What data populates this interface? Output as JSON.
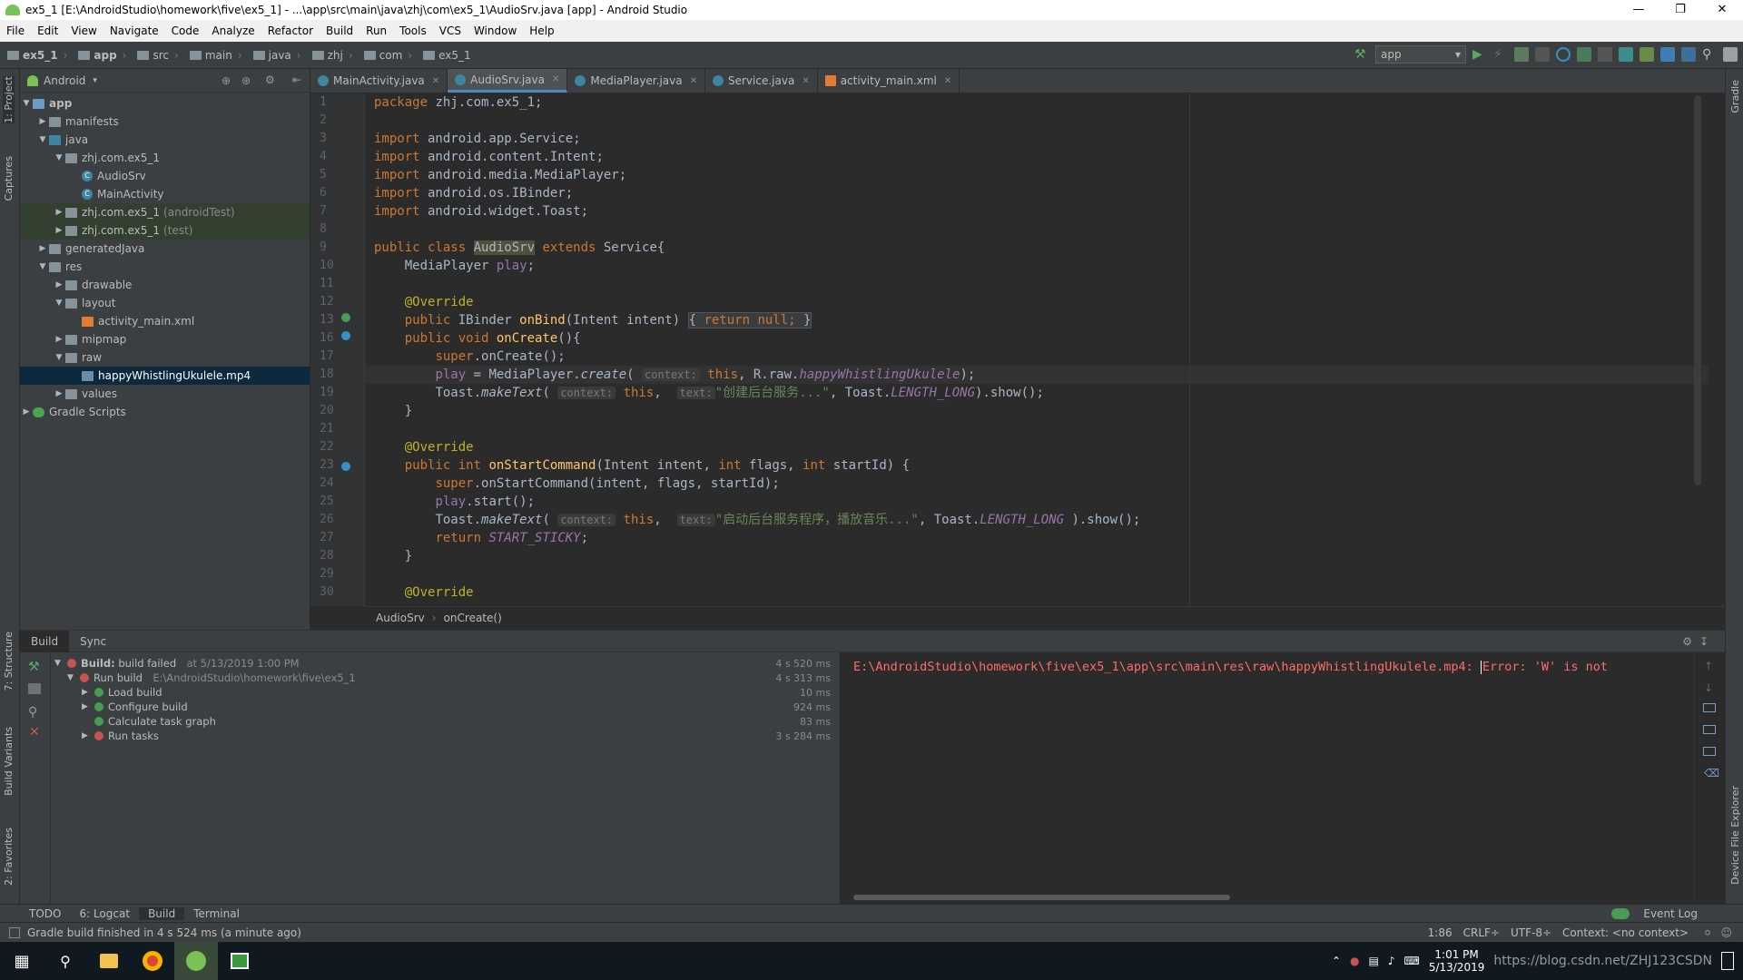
{
  "window": {
    "title": "ex5_1 [E:\\AndroidStudio\\homework\\five\\ex5_1] - ...\\app\\src\\main\\java\\zhj\\com\\ex5_1\\AudioSrv.java [app] - Android Studio"
  },
  "menu": [
    "File",
    "Edit",
    "View",
    "Navigate",
    "Code",
    "Analyze",
    "Refactor",
    "Build",
    "Run",
    "Tools",
    "VCS",
    "Window",
    "Help"
  ],
  "breadcrumbs": [
    "ex5_1",
    "app",
    "src",
    "main",
    "java",
    "zhj",
    "com",
    "ex5_1"
  ],
  "run_config": "app",
  "project_panel": {
    "view": "Android",
    "tree": [
      {
        "label": "app",
        "extra": ""
      },
      {
        "label": "manifests",
        "extra": ""
      },
      {
        "label": "java",
        "extra": ""
      },
      {
        "label": "zhj.com.ex5_1",
        "extra": ""
      },
      {
        "label": "AudioSrv",
        "extra": ""
      },
      {
        "label": "MainActivity",
        "extra": ""
      },
      {
        "label": "zhj.com.ex5_1",
        "extra": "(androidTest)"
      },
      {
        "label": "zhj.com.ex5_1",
        "extra": "(test)"
      },
      {
        "label": "generatedJava",
        "extra": ""
      },
      {
        "label": "res",
        "extra": ""
      },
      {
        "label": "drawable",
        "extra": ""
      },
      {
        "label": "layout",
        "extra": ""
      },
      {
        "label": "activity_main.xml",
        "extra": ""
      },
      {
        "label": "mipmap",
        "extra": ""
      },
      {
        "label": "raw",
        "extra": ""
      },
      {
        "label": "happyWhistlingUkulele.mp4",
        "extra": ""
      },
      {
        "label": "values",
        "extra": ""
      },
      {
        "label": "Gradle Scripts",
        "extra": ""
      }
    ]
  },
  "side_tools": {
    "project": "1: Project",
    "captures": "Captures",
    "structure": "7: Structure",
    "build_variants": "Build Variants",
    "favorites": "2: Favorites",
    "gradle": "Gradle",
    "device_explorer": "Device File Explorer"
  },
  "editor_tabs": [
    "MainActivity.java",
    "AudioSrv.java",
    "MediaPlayer.java",
    "Service.java",
    "activity_main.xml"
  ],
  "line_numbers": [
    "1",
    "2",
    "3",
    "4",
    "5",
    "6",
    "7",
    "8",
    "9",
    "10",
    "11",
    "12",
    "13",
    "16",
    "17",
    "18",
    "19",
    "20",
    "21",
    "22",
    "23",
    "24",
    "25",
    "26",
    "27",
    "28",
    "29",
    "30"
  ],
  "code": {
    "l1a": "package",
    "l1b": " zhj.com.ex5_1;",
    "imp": "import",
    "i1": " android.app.Service;",
    "i2": " android.content.Intent;",
    "i3": " android.media.MediaPlayer;",
    "i4": " android.os.IBinder;",
    "i5": " android.widget.Toast;",
    "cls_kw": "public class ",
    "cls_name": "AudioSrv",
    "ext_kw": " extends ",
    "ext_name": "Service{",
    "fld_type": "    MediaPlayer ",
    "fld_name": "play",
    ";": ";",
    "override": "    @Override",
    "onbind_kw": "    public ",
    "onbind_t": "IBinder ",
    "onbind_fn": "onBind",
    "onbind_args": "(Intent intent) ",
    "onbind_body_kw": "return null;",
    "oncreate_kw": "    public void ",
    "oncreate_fn": "onCreate",
    "oncreate_args": "(){",
    "super1": "super",
    ".oncreate": ".onCreate();",
    "play_assign": "play",
    " = MediaPlayer.": " = MediaPlayer.",
    "create": "create",
    "(": "(",
    "hint_context": "context:",
    "this": "this",
    ", R.raw.": ", R.raw.",
    "rawname": "happyWhistlingUkulele",
    ");": ");",
    "toast": "Toast.",
    "maketext": "makeText",
    "hint_text": "text:",
    "str1": "\"创建后台服务...\"",
    ", Toast.": ", Toast.",
    "LONG": "LENGTH_LONG",
    ").show();": ").show();",
    "closebrace": "    }",
    "onstart_kw": "    public int ",
    "onstart_fn": "onStartCommand",
    "onstart_args1": "(Intent intent, ",
    "int": "int",
    "flags": " flags, ",
    "startId": " startId) {",
    ".onStartCommand": ".onStartCommand(intent, flags, startId);",
    ".start": ".start();",
    "str2": "\"启动后台服务程序，播放音乐...\"",
    " ).show();": " ).show();",
    "return": "return ",
    "sticky": "START_STICKY",
    "indent8": "        "
  },
  "editor_breadcrumb": [
    "AudioSrv",
    "onCreate()"
  ],
  "build_panel": {
    "tabs": [
      "Build",
      "Sync"
    ],
    "rows": [
      {
        "label": "Build:",
        "label2": "build failed",
        "info": "at 5/13/2019 1:00 PM",
        "time": "4 s 520 ms"
      },
      {
        "label": "Run build",
        "info": "E:\\AndroidStudio\\homework\\five\\ex5_1",
        "time": "4 s 313 ms"
      },
      {
        "label": "Load build",
        "time": "10 ms"
      },
      {
        "label": "Configure build",
        "time": "924 ms"
      },
      {
        "label": "Calculate task graph",
        "time": "83 ms"
      },
      {
        "label": "Run tasks",
        "time": "3 s 284 ms"
      }
    ],
    "output_path": "E:\\AndroidStudio\\homework\\five\\ex5_1\\app\\src\\main\\res\\raw\\happyWhistlingUkulele.mp4: ",
    "output_error": "Error: 'W' is not"
  },
  "bottom_tabs": [
    "TODO",
    "6: Logcat",
    "Build",
    "Terminal"
  ],
  "event_log": "Event Log",
  "status": {
    "message": "Gradle build finished in 4 s 524 ms (a minute ago)",
    "position": "1:86",
    "line_sep": "CRLF÷",
    "encoding": "UTF-8÷",
    "context": "Context: <no context>"
  },
  "taskbar": {
    "time": "1:01 PM",
    "date": "5/13/2019",
    "watermark": "https://blog.csdn.net/ZHJ123CSDN"
  },
  "colors": {
    "accent": "#4a88c7",
    "error": "#ff6b68",
    "success": "#499c54"
  }
}
